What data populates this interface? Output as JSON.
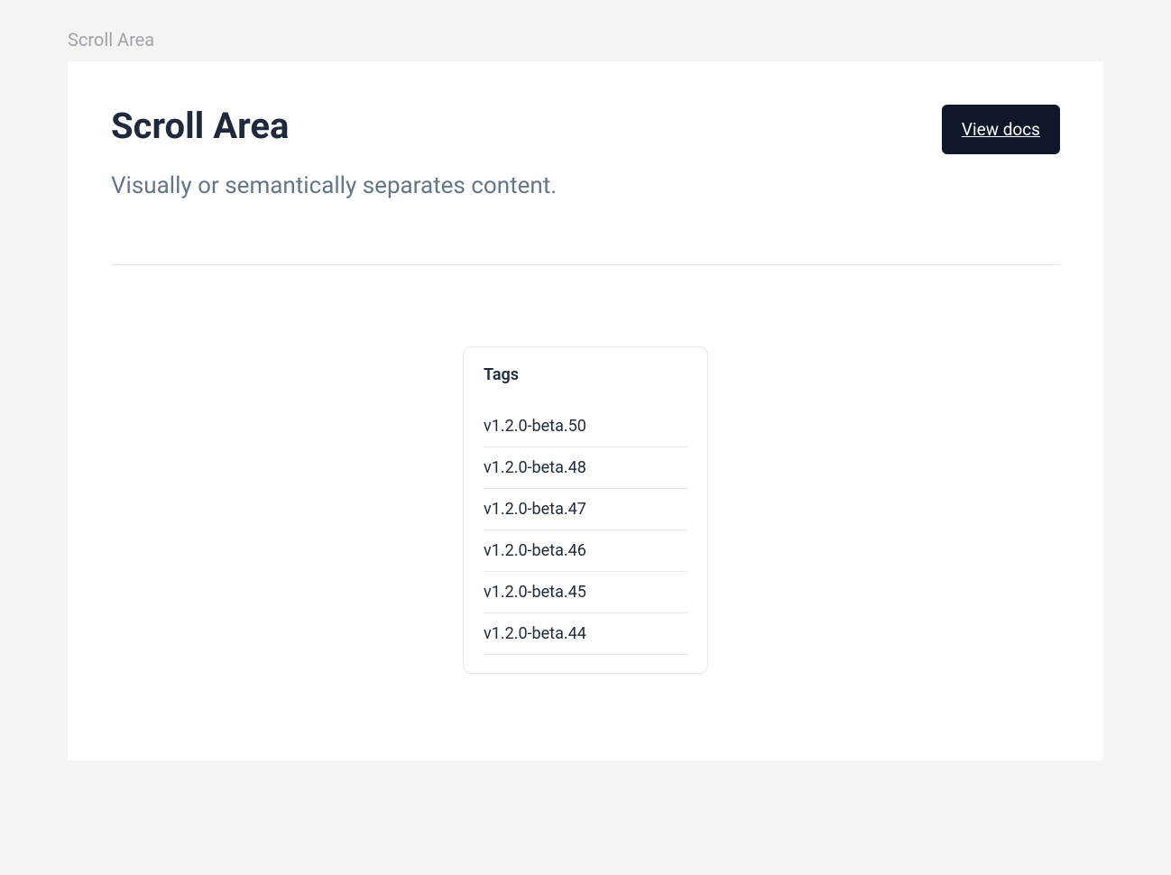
{
  "breadcrumb": "Scroll Area",
  "header": {
    "title": "Scroll Area",
    "subtitle": "Visually or semantically separates content.",
    "view_docs_label": "View docs"
  },
  "scroll_box": {
    "title": "Tags",
    "tags": [
      "v1.2.0-beta.50",
      "v1.2.0-beta.48",
      "v1.2.0-beta.47",
      "v1.2.0-beta.46",
      "v1.2.0-beta.45",
      "v1.2.0-beta.44"
    ]
  }
}
